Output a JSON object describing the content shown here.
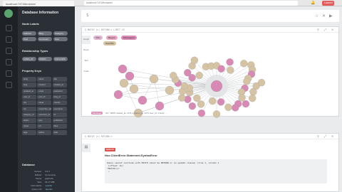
{
  "browser": {
    "tab_title": "localhost:7474/browser/",
    "url": "localhost:7474/browser/",
    "extension_label": "Laravel"
  },
  "sidebar": {
    "title": "Database Information",
    "node_labels_heading": "Node Labels",
    "node_labels": [
      "Address",
      "Blog",
      "Category",
      "Post",
      "Comment",
      "User"
    ],
    "rel_types_heading": "Relationship Types",
    "rel_types": [
      "LIVES_AT",
      "OWNS",
      "FOLLOWS"
    ],
    "property_keys_heading": "Property Keys",
    "property_keys": [
      "body",
      "name",
      "title",
      "slug",
      "content",
      "created_at",
      "updated_at",
      "email",
      "password",
      "user_id",
      "post_id",
      "blog_id",
      "city",
      "street",
      "country",
      "zip",
      "remember_token",
      "username",
      "category_id",
      "comment_id",
      "id",
      "status",
      "type",
      "published",
      "views",
      "url",
      "likes",
      "tags",
      "author",
      "date"
    ],
    "database_heading": "Database",
    "db_info": [
      {
        "k": "Version:",
        "v": "3.0.3"
      },
      {
        "k": "Edition:",
        "v": "Community"
      },
      {
        "k": "Name:",
        "v": "graph.db"
      },
      {
        "k": "Size:",
        "v": "33.17 MiB"
      },
      {
        "k": "Information:",
        "v": ":sysinfo"
      },
      {
        "k": "Query List:",
        "v": ":queries"
      }
    ]
  },
  "editor": {
    "prompt": "$"
  },
  "graph_frame": {
    "command": "$ MATCH (n) RETURN n LIMIT 25",
    "tabs": [
      "Graph",
      "Rows",
      "Text",
      "Code"
    ],
    "legend": [
      {
        "label": "*(61)",
        "color": "#e0b6d0"
      },
      {
        "label": "Blog(3)",
        "color": "#e8a6c0"
      },
      {
        "label": "Message(2)",
        "color": "#d98ab4"
      },
      {
        "label": "User(56)",
        "color": "#d6c3a4"
      }
    ],
    "status_label": "Message",
    "status_text": "<id>: 2805  created_at: 1471  updated_at: 1471  user_id: 1  body: ..."
  },
  "error_frame": {
    "command": "$ MATCH (n) RETURN n",
    "badge": "ERROR",
    "title": "Neo.ClientError.Statement.SyntaxError",
    "message": "Query cannot conclude with MATCH (must be RETURN or an update clause) (line 1, column 1\n (offset: 0))\n\"MATCH(n)\"\n ^"
  },
  "colors": {
    "node_pink": "#d98ab4",
    "node_tan": "#d6c3a4",
    "sidebar_bg": "#2a3036",
    "rail_bg": "#1e2226"
  }
}
